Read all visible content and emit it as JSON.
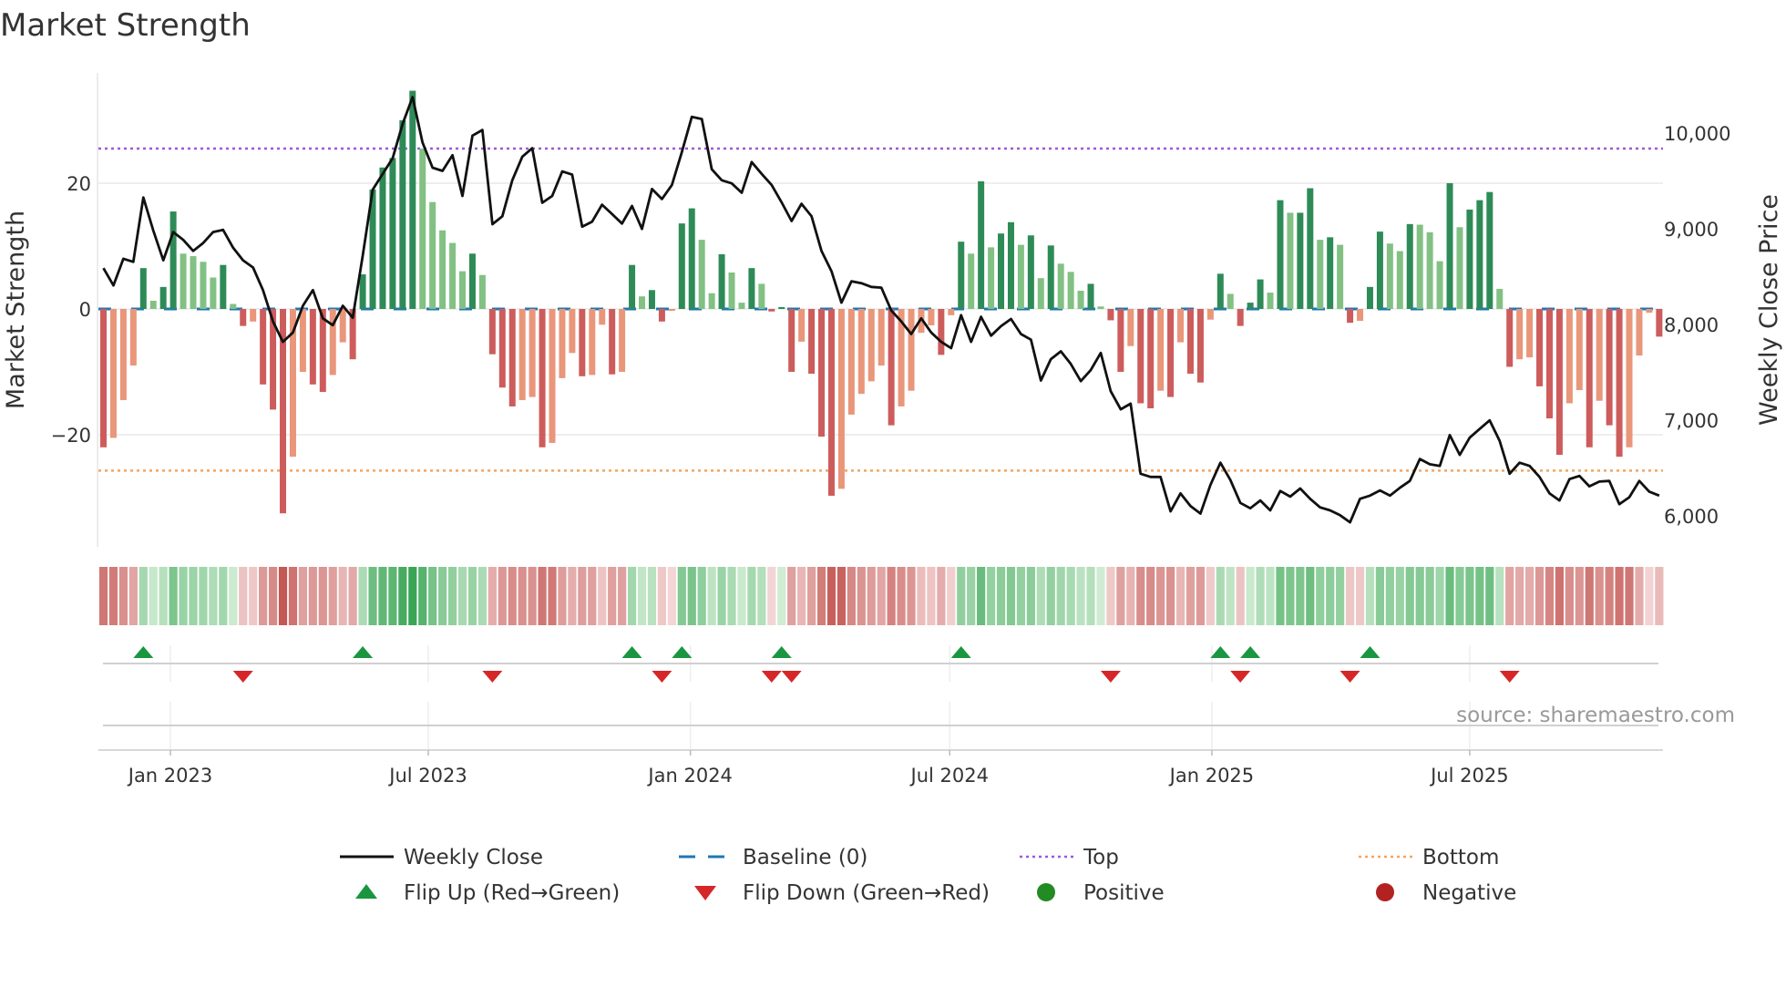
{
  "title": "Market Strength",
  "source": "source: sharemaestro.com",
  "colors": {
    "strong_positive": "#2e8b57",
    "weak_positive": "#82c183",
    "strong_negative": "#cd5c5c",
    "weak_negative": "#e9967a",
    "line": "#111111",
    "baseline": "#1f77b4",
    "top": "#9b59d6",
    "bottom": "#f4a460",
    "flip_up": "#1a9641",
    "flip_down": "#d62728",
    "positive": "#228b22",
    "negative": "#b22222"
  },
  "legend": [
    {
      "label": "Weekly Close",
      "kind": "line"
    },
    {
      "label": "Baseline (0)",
      "kind": "dash"
    },
    {
      "label": "Top",
      "kind": "top"
    },
    {
      "label": "Bottom",
      "kind": "bottom"
    },
    {
      "label": "Flip Up (Red→Green)",
      "kind": "up"
    },
    {
      "label": "Flip Down (Green→Red)",
      "kind": "down"
    },
    {
      "label": "Positive",
      "kind": "pos"
    },
    {
      "label": "Negative",
      "kind": "neg"
    }
  ],
  "chart_data": {
    "type": "bar",
    "title": "Market Strength",
    "ylabel": "Market Strength",
    "y2label": "Weekly Close Price",
    "ylim": [
      -36,
      38
    ],
    "y2lim": [
      5850,
      10650
    ],
    "yticks": [
      {
        "v": 20,
        "label": "20"
      },
      {
        "v": 0,
        "label": "0"
      },
      {
        "v": -20,
        "label": "−20"
      }
    ],
    "y2ticks": [
      {
        "v": 10000,
        "label": "10,000"
      },
      {
        "v": 9000,
        "label": "9,000"
      },
      {
        "v": 8000,
        "label": "8,000"
      },
      {
        "v": 7000,
        "label": "7,000"
      },
      {
        "v": 6000,
        "label": "6,000"
      }
    ],
    "xticks": [
      {
        "date": "2023-01-01",
        "label": "Jan 2023"
      },
      {
        "date": "2023-07-01",
        "label": "Jul 2023"
      },
      {
        "date": "2024-01-01",
        "label": "Jan 2024"
      },
      {
        "date": "2024-07-01",
        "label": "Jul 2024"
      },
      {
        "date": "2025-01-01",
        "label": "Jan 2025"
      },
      {
        "date": "2025-07-01",
        "label": "Jul 2025"
      }
    ],
    "first_week": "2022-11-15",
    "step_days": 7,
    "top": 25.5,
    "bottom": -25.7,
    "baseline": 0,
    "strength": [
      -22,
      -20.5,
      -14.5,
      -9,
      6.5,
      1.3,
      3.5,
      15.5,
      8.8,
      8.4,
      7.5,
      5,
      7,
      0.8,
      -2.7,
      -2,
      -12,
      -16,
      -32.5,
      -23.5,
      -10,
      -12,
      -13.2,
      -10.5,
      -5.3,
      -8,
      5.5,
      19,
      22.5,
      24,
      30,
      34.7,
      25.5,
      17,
      12.5,
      10.5,
      6,
      8.8,
      5.4,
      -7.2,
      -12.5,
      -15.5,
      -14.5,
      -14,
      -22,
      -21.3,
      -11,
      -7,
      -10.7,
      -10.5,
      -2.5,
      -10.4,
      -10,
      7,
      2,
      3,
      -2,
      -0.3,
      13.6,
      16,
      11,
      2.5,
      8.7,
      5.8,
      1,
      6.5,
      4,
      -0.4,
      0.3,
      -10,
      -5.2,
      -10.3,
      -20.3,
      -29.7,
      -28.6,
      -16.8,
      -13.5,
      -11.5,
      -9,
      -18.5,
      -15.5,
      -13,
      -3.8,
      -2.6,
      -7.3,
      -1,
      10.7,
      8.8,
      20.3,
      9.8,
      12,
      13.8,
      10.2,
      11.7,
      4.9,
      10.1,
      7.2,
      5.9,
      2.9,
      4,
      0.4,
      -1.8,
      -10,
      -5.9,
      -15,
      -15.8,
      -13,
      -14,
      -5.3,
      -10.3,
      -11.7,
      -1.7,
      5.6,
      2.4,
      -2.7,
      1,
      4.7,
      2.6,
      17.3,
      15.3,
      15.3,
      19.2,
      11,
      11.4,
      10.2,
      -2.2,
      -1.9,
      3.5,
      12.3,
      10.4,
      9.2,
      13.5,
      13.4,
      12.2,
      7.6,
      20,
      13,
      15.8,
      17.3,
      18.6,
      3.2,
      -9.2,
      -8,
      -7.7,
      -12.3,
      -17.4,
      -23.2,
      -15,
      -12.9,
      -22,
      -14.6,
      -18.5,
      -23.5,
      -22,
      -7.4,
      -0.6,
      -4.4
    ],
    "weekly_close": [
      8589,
      8408,
      8687,
      8654,
      9327,
      8982,
      8670,
      8966,
      8884,
      8769,
      8851,
      8966,
      8989,
      8802,
      8670,
      8595,
      8359,
      8031,
      7818,
      7916,
      8195,
      8359,
      8064,
      7992,
      8195,
      8070,
      8720,
      9409,
      9573,
      9737,
      10097,
      10376,
      9901,
      9638,
      9605,
      9769,
      9343,
      9973,
      10032,
      9048,
      9130,
      9507,
      9753,
      9842,
      9271,
      9343,
      9599,
      9566,
      9022,
      9074,
      9251,
      9153,
      9054,
      9238,
      8998,
      9415,
      9310,
      9458,
      9802,
      10170,
      10147,
      9622,
      9507,
      9474,
      9376,
      9697,
      9573,
      9458,
      9277,
      9081,
      9261,
      9130,
      8769,
      8556,
      8228,
      8451,
      8431,
      8392,
      8385,
      8146,
      8031,
      7900,
      8064,
      7916,
      7818,
      7752,
      8097,
      7818,
      8080,
      7883,
      7982,
      8057,
      7900,
      7841,
      7414,
      7637,
      7719,
      7588,
      7408,
      7523,
      7703,
      7303,
      7113,
      7172,
      6440,
      6407,
      6407,
      6047,
      6234,
      6102,
      6024,
      6325,
      6555,
      6375,
      6135,
      6079,
      6161,
      6057,
      6260,
      6201,
      6286,
      6178,
      6089,
      6057,
      6007,
      5932,
      6178,
      6211,
      6266,
      6211,
      6293,
      6365,
      6594,
      6539,
      6522,
      6844,
      6637,
      6817,
      6909,
      6998,
      6785,
      6440,
      6555,
      6522,
      6407,
      6234,
      6161,
      6384,
      6417,
      6309,
      6358,
      6365,
      6122,
      6194,
      6365,
      6253,
      6211
    ]
  }
}
